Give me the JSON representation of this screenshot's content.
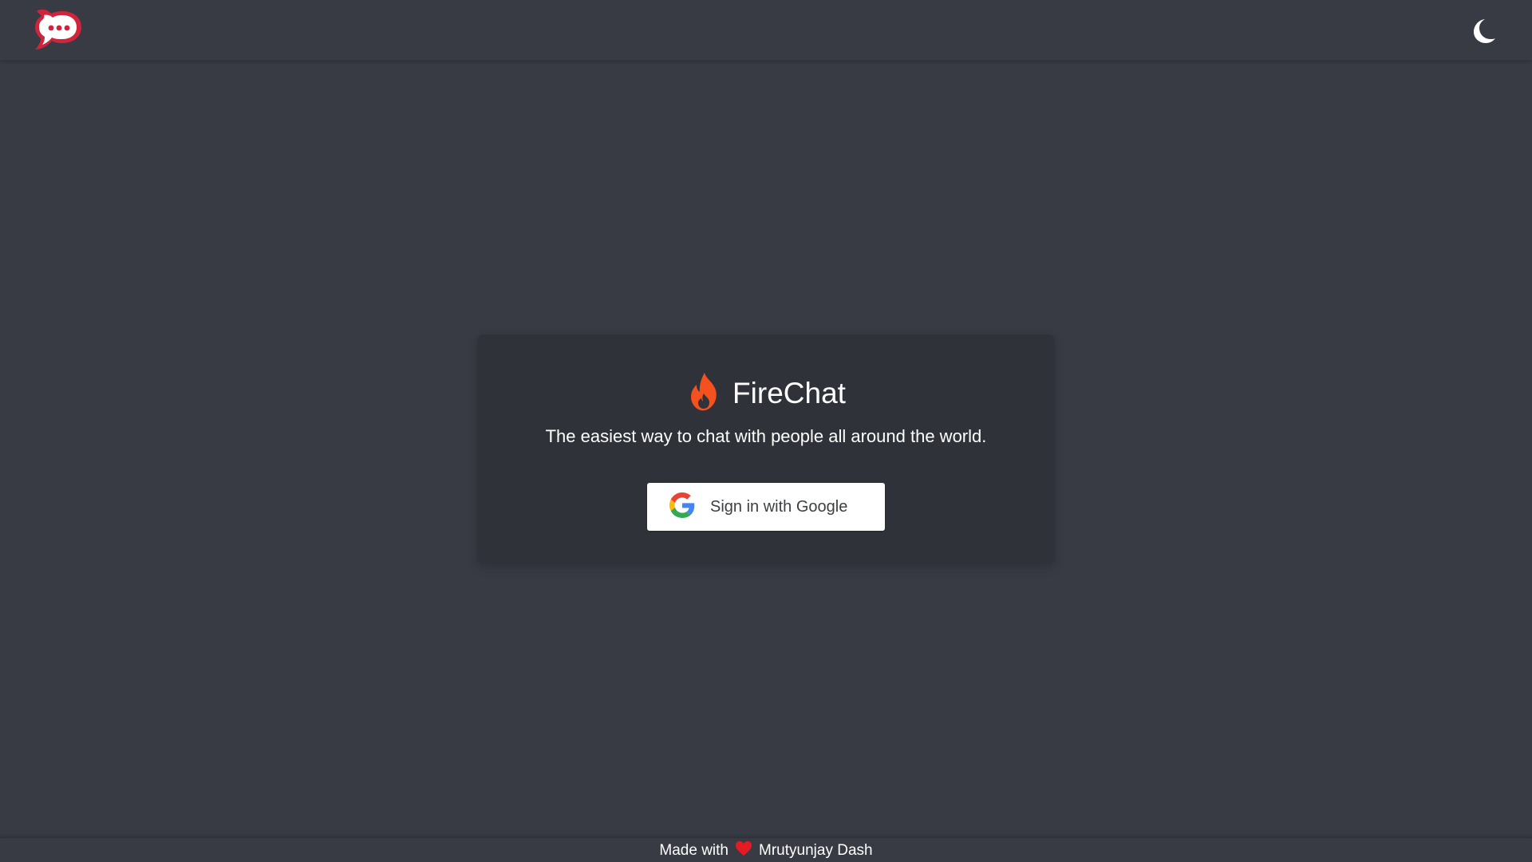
{
  "header": {
    "logo_icon": "rocket-chat-bubble-icon",
    "theme_toggle_icon": "moon-icon"
  },
  "card": {
    "brand_icon": "flame-icon",
    "title": "FireChat",
    "tagline": "The easiest way to chat with people all around the world.",
    "signin_button_label": "Sign in with Google",
    "signin_icon": "google-g-icon"
  },
  "footer": {
    "made_with": "Made with",
    "heart_icon": "heart-icon",
    "author": "Mrutyunjay Dash"
  },
  "colors": {
    "background": "#383b44",
    "card": "#30323a",
    "flame": "#f4511e",
    "logo_red": "#d0243c",
    "heart": "#e31b23",
    "button_bg": "#ffffff",
    "button_text": "#3c4043"
  }
}
